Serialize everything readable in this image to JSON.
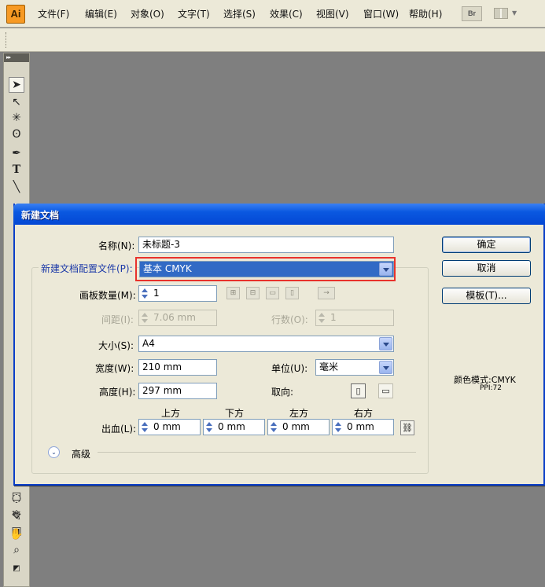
{
  "app": {
    "logo": "Ai"
  },
  "menu": [
    "文件(F)",
    "编辑(E)",
    "对象(O)",
    "文字(T)",
    "选择(S)",
    "效果(C)",
    "视图(V)",
    "窗口(W)",
    "帮助(H)"
  ],
  "toolbar": {
    "bridge_label": "Br"
  },
  "tools_panel": {
    "header": "▸▸"
  },
  "dialog": {
    "title": "新建文档",
    "name_label": "名称(N):",
    "name_value": "未标题-3",
    "profile_label": "新建文档配置文件(P):",
    "profile_value": "基本 CMYK",
    "artboard_count_label": "画板数量(M):",
    "artboard_count_value": "1",
    "spacing_label": "间距(I):",
    "spacing_value": "7.06 mm",
    "rows_label": "行数(O):",
    "rows_value": "1",
    "size_label": "大小(S):",
    "size_value": "A4",
    "width_label": "宽度(W):",
    "width_value": "210 mm",
    "units_label": "单位(U):",
    "units_value": "毫米",
    "height_label": "高度(H):",
    "height_value": "297 mm",
    "orientation_label": "取向:",
    "bleed_label": "出血(L):",
    "bleed_top_label": "上方",
    "bleed_bottom_label": "下方",
    "bleed_left_label": "左方",
    "bleed_right_label": "右方",
    "bleed_top_value": "0 mm",
    "bleed_bottom_value": "0 mm",
    "bleed_left_value": "0 mm",
    "bleed_right_value": "0 mm",
    "advanced_label": "高级",
    "ok_label": "确定",
    "cancel_label": "取消",
    "templates_label": "模板(T)...",
    "color_mode": "颜色模式:CMYK",
    "ppi": "PPI:72"
  },
  "colors": {
    "titlebar": "#0a58e0",
    "selection": "#316ac5",
    "highlight_border": "#e8322b",
    "dialog_bg": "#ece9d8",
    "canvas_bg": "#7f7f7f"
  }
}
